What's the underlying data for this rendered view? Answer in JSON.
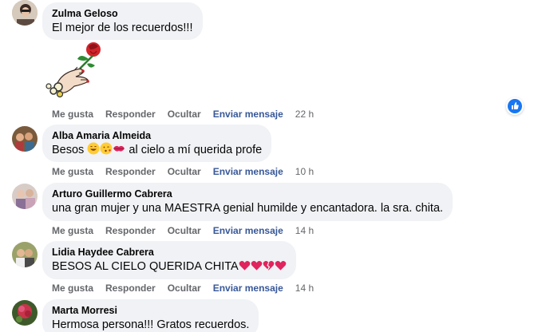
{
  "colors": {
    "bubble": "#f0f2f5",
    "action_text": "#65676b",
    "send_message": "#385898",
    "like_blue": "#1877f2",
    "heart_red": "#e0245e"
  },
  "comments": [
    {
      "author": "Zulma Geloso",
      "text": "El mejor de los recuerdos!!!",
      "has_sticker": true,
      "sticker_icon": "hand-holding-rose-sticker",
      "actions": {
        "like": "Me gusta",
        "reply": "Responder",
        "hide": "Ocultar",
        "message": "Enviar mensaje",
        "time": "22 h"
      },
      "reaction_icon": "like-icon"
    },
    {
      "author": "Alba Amaria Almeida",
      "text_before": "Besos ",
      "emojis": [
        "grinning-face",
        "face-blowing-kiss",
        "kiss-mark"
      ],
      "text_after": " al cielo a mí querida profe",
      "actions": {
        "like": "Me gusta",
        "reply": "Responder",
        "hide": "Ocultar",
        "message": "Enviar mensaje",
        "time": "10 h"
      }
    },
    {
      "author": "Arturo Guillermo Cabrera",
      "text": "una gran mujer y una MAESTRA genial humilde y encantadora. la sra. chita.",
      "actions": {
        "like": "Me gusta",
        "reply": "Responder",
        "hide": "Ocultar",
        "message": "Enviar mensaje",
        "time": "14 h"
      }
    },
    {
      "author": "Lidia Haydee Cabrera",
      "text": "BESOS AL CIELO QUERIDA CHITA",
      "emojis": [
        "red-heart",
        "red-heart",
        "broken-heart",
        "red-heart"
      ],
      "actions": {
        "like": "Me gusta",
        "reply": "Responder",
        "hide": "Ocultar",
        "message": "Enviar mensaje",
        "time": "14 h"
      }
    },
    {
      "author": "Marta Morresi",
      "text": "Hermosa persona!!! Gratos recuerdos."
    }
  ]
}
